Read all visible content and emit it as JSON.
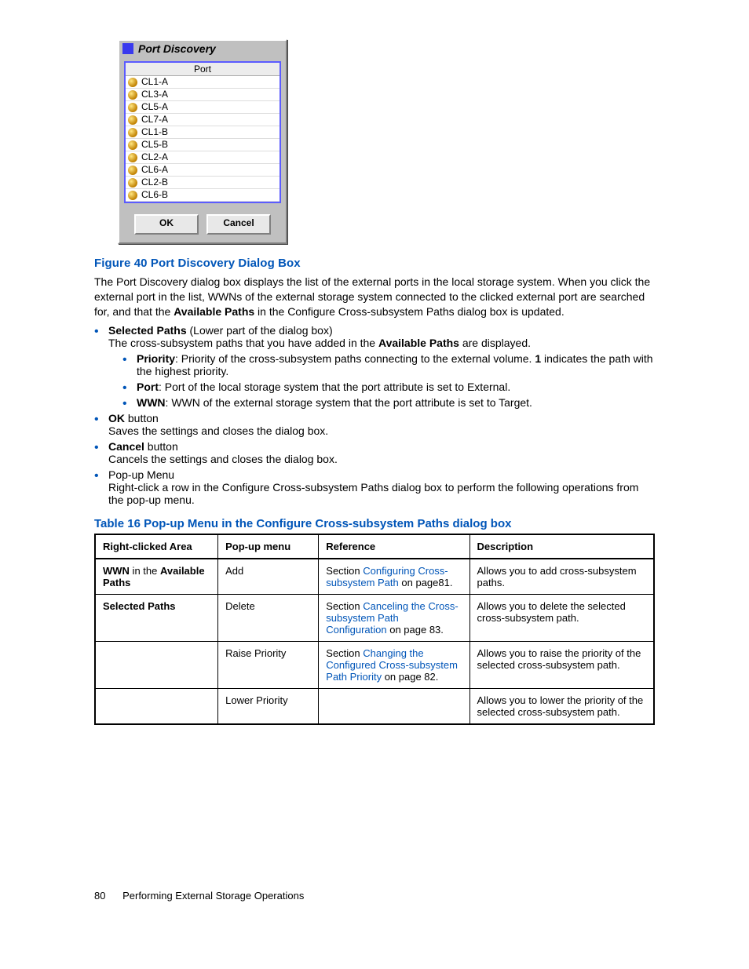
{
  "dialog": {
    "title": "Port Discovery",
    "column_header": "Port",
    "ports": [
      "CL1-A",
      "CL3-A",
      "CL5-A",
      "CL7-A",
      "CL1-B",
      "CL5-B",
      "CL2-A",
      "CL6-A",
      "CL2-B",
      "CL6-B"
    ],
    "ok": "OK",
    "cancel": "Cancel"
  },
  "figure_caption": "Figure 40 Port Discovery Dialog Box",
  "para1_a": "The Port Discovery dialog box displays the list of the external ports in the local storage system. When you click the external port in the list, WWNs of the external storage system connected to the clicked external port are searched for, and that the ",
  "para1_bold": "Available Paths",
  "para1_b": " in the Configure Cross-subsystem Paths dialog box is updated.",
  "li_selected_b": "Selected Paths",
  "li_selected_t": " (Lower part of the dialog box)",
  "li_selected_p_a": "The cross-subsystem paths that you have added in the ",
  "li_selected_p_bold": "Available Paths",
  "li_selected_p_b": " are displayed.",
  "inner": {
    "priority_b": "Priority",
    "priority_t": ": Priority of the cross-subsystem paths connecting to the external volume. ",
    "priority_bold1": "1",
    "priority_t2": " indicates the path with the highest priority.",
    "port_b": "Port",
    "port_t": ": Port of the local storage system that the port attribute is set to External.",
    "wwn_b": "WWN",
    "wwn_t": ": WWN of the external storage system that the port attribute is set to Target."
  },
  "li_ok_b": "OK",
  "li_ok_t": " button",
  "li_ok_p": "Saves the settings and closes the dialog box.",
  "li_cancel_b": "Cancel",
  "li_cancel_t": " button",
  "li_cancel_p": "Cancels the settings and closes the dialog box.",
  "li_popup_t": "Pop-up Menu",
  "li_popup_p": "Right-click a row in the Configure Cross-subsystem Paths dialog box to perform the following operations from the pop-up menu.",
  "table_caption": "Table 16 Pop-up Menu in the Configure Cross-subsystem Paths dialog box",
  "table": {
    "headers": [
      "Right-clicked Area",
      "Pop-up menu",
      "Reference",
      "Description"
    ],
    "rows": [
      {
        "area_b1": "WWN",
        "area_t1": " in the ",
        "area_b2": "Available Paths",
        "menu": "Add",
        "ref_pre": "Section ",
        "ref_link": "Configuring Cross-subsystem Path",
        "ref_post": " on page81.",
        "desc": "Allows you to add cross-subsystem paths."
      },
      {
        "area_b1": "Selected Paths",
        "area_t1": "",
        "area_b2": "",
        "menu": "Delete",
        "ref_pre": "Section ",
        "ref_link": "Canceling the Cross-subsystem Path Configuration",
        "ref_post": " on page 83.",
        "desc": "Allows you to delete the selected cross-subsystem path."
      },
      {
        "area_b1": "",
        "area_t1": "",
        "area_b2": "",
        "menu": "Raise Priority",
        "ref_pre": "Section ",
        "ref_link": "Changing the Configured Cross-subsystem Path Priority",
        "ref_post": " on page 82.",
        "desc": "Allows you to raise the priority of the selected cross-subsystem path."
      },
      {
        "area_b1": "",
        "area_t1": "",
        "area_b2": "",
        "menu": "Lower Priority",
        "ref_pre": "",
        "ref_link": "",
        "ref_post": "",
        "desc": "Allows you to lower the priority of the selected cross-subsystem path."
      }
    ]
  },
  "footer_page": "80",
  "footer_text": "Performing External Storage Operations"
}
